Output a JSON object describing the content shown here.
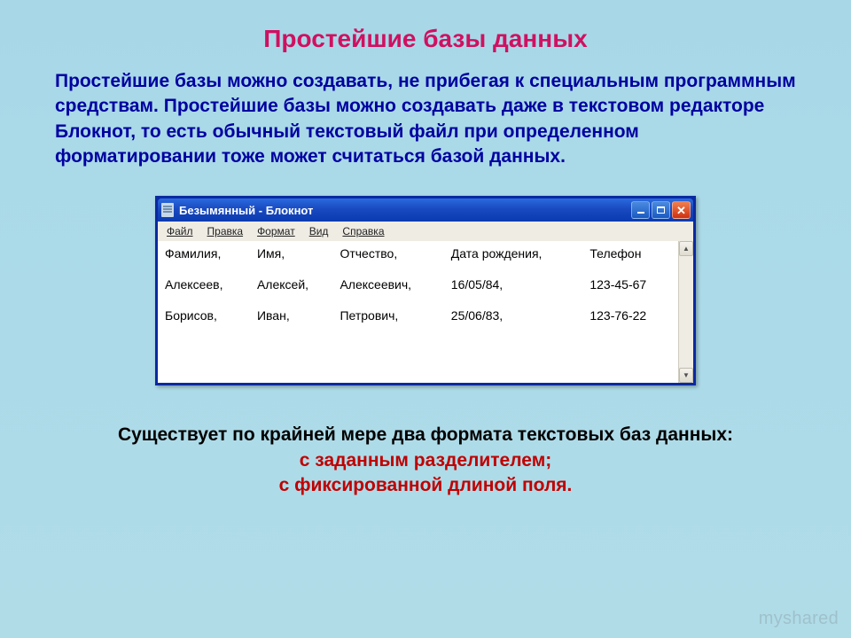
{
  "slide": {
    "title": "Простейшие базы данных",
    "intro": "Простейшие базы можно создавать, не прибегая к специальным программным средствам. Простейшие базы можно создавать даже в текстовом редакторе Блокнот, то есть обычный текстовый файл при определенном форматировании тоже может считаться базой данных."
  },
  "notepad": {
    "title": "Безымянный - Блокнот",
    "menu": {
      "file": "Файл",
      "edit": "Правка",
      "format": "Формат",
      "view": "Вид",
      "help": "Справка"
    },
    "headers": {
      "c0": "Фамилия,",
      "c1": "Имя,",
      "c2": "Отчество,",
      "c3": "Дата рождения,",
      "c4": "Телефон"
    },
    "rows": [
      {
        "c0": "Алексеев,",
        "c1": "Алексей,",
        "c2": "Алексеевич,",
        "c3": "16/05/84,",
        "c4": "123-45-67"
      },
      {
        "c0": "Борисов,",
        "c1": "Иван,",
        "c2": "Петрович,",
        "c3": "25/06/83,",
        "c4": "123-76-22"
      }
    ],
    "scroll": {
      "up": "▲",
      "down": "▼"
    }
  },
  "footer": {
    "line1": "Существует по крайней мере два формата текстовых баз данных:",
    "line2": "с заданным разделителем;",
    "line3": "с фиксированной длиной поля."
  },
  "watermark": "myshared"
}
